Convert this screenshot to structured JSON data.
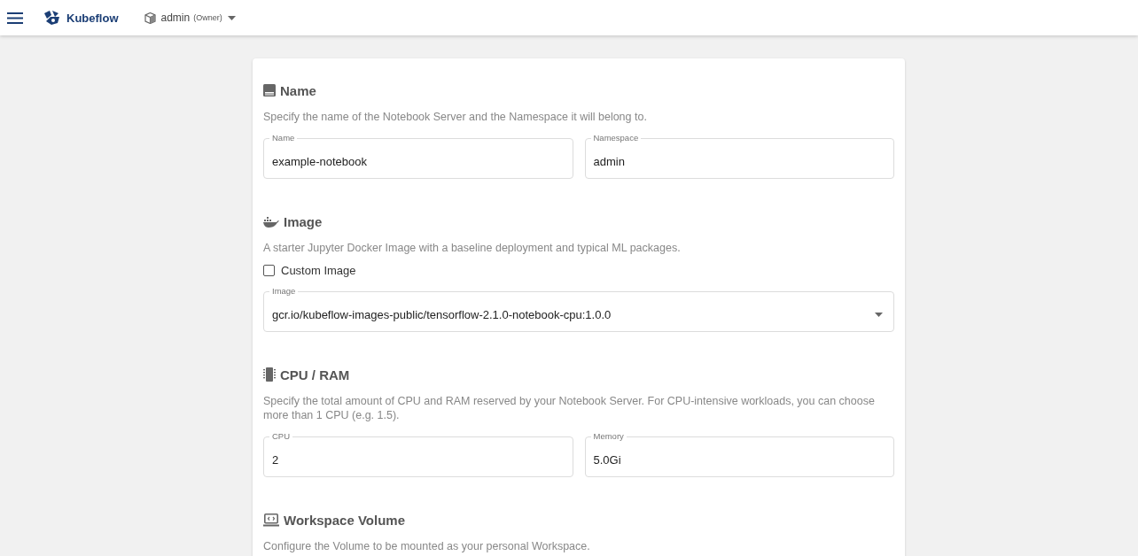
{
  "topbar": {
    "brand": "Kubeflow",
    "namespace": {
      "name": "admin",
      "role": "(Owner)"
    }
  },
  "sections": [
    {
      "title": "Name",
      "description": "Specify the name of the Notebook Server and the Namespace it will belong to.",
      "fields": [
        {
          "kind": "text",
          "label": "Name",
          "value": "example-notebook"
        },
        {
          "kind": "text",
          "label": "Namespace",
          "value": "admin"
        }
      ]
    },
    {
      "title": "Image",
      "description": "A starter Jupyter Docker Image with a baseline deployment and typical ML packages.",
      "checkbox": {
        "label": "Custom Image",
        "checked": false
      },
      "fields": [
        {
          "kind": "select",
          "label": "Image",
          "value": "gcr.io/kubeflow-images-public/tensorflow-2.1.0-notebook-cpu:1.0.0"
        }
      ]
    },
    {
      "title": "CPU / RAM",
      "description": "Specify the total amount of CPU and RAM reserved by your Notebook Server. For CPU-intensive workloads, you can choose more than 1 CPU (e.g. 1.5).",
      "fields": [
        {
          "kind": "text",
          "label": "CPU",
          "value": "2"
        },
        {
          "kind": "text",
          "label": "Memory",
          "value": "5.0Gi"
        }
      ]
    },
    {
      "title": "Workspace Volume",
      "description": "Configure the Volume to be mounted as your personal Workspace."
    }
  ]
}
